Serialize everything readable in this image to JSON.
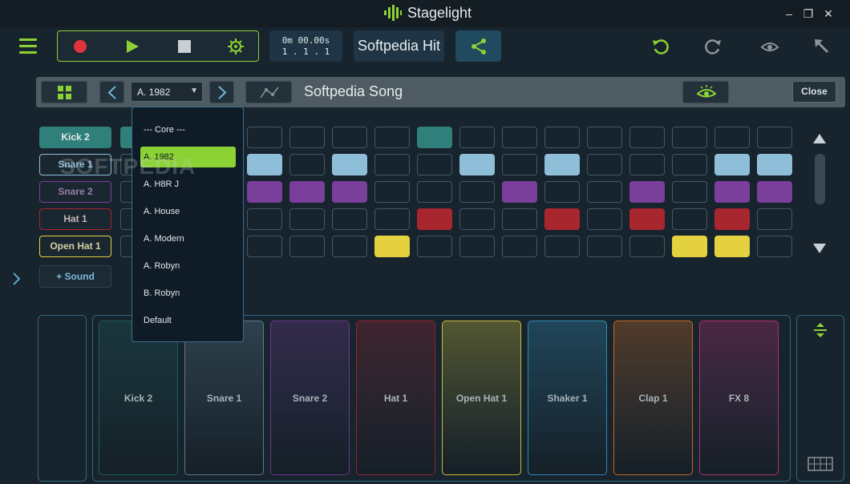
{
  "app": {
    "title": "Stagelight",
    "icon": "waveform-logo-icon"
  },
  "window_controls": {
    "minimize": "–",
    "maximize": "❐",
    "close": "✕"
  },
  "toolbar": {
    "time_top": "0m 00.00s",
    "time_bottom": "1 . 1 . 1",
    "project_title": "Softpedia Hit"
  },
  "songbar": {
    "preset": "A. 1982",
    "song_name": "Softpedia Song",
    "close_label": "Close"
  },
  "tracks": [
    {
      "label": "Kick 2",
      "color": "#2f7f7a",
      "active": true
    },
    {
      "label": "Snare 1",
      "color": "#8fbfd8",
      "active": false
    },
    {
      "label": "Snare 2",
      "color": "#7a3f9a",
      "active": false
    },
    {
      "label": "Hat 1",
      "color": "#a8262e",
      "active": false
    },
    {
      "label": "Open Hat 1",
      "color": "#e3d140",
      "active": false
    }
  ],
  "add_sound_label": "+ Sound",
  "step_grid": {
    "active_steps": [
      [
        0,
        0,
        0,
        0,
        1,
        0,
        0,
        0,
        0,
        0,
        0,
        0,
        0
      ],
      [
        1,
        0,
        1,
        0,
        0,
        1,
        0,
        1,
        0,
        0,
        0,
        1,
        1
      ],
      [
        1,
        1,
        1,
        0,
        0,
        0,
        1,
        0,
        0,
        1,
        0,
        1,
        1
      ],
      [
        0,
        0,
        0,
        0,
        1,
        0,
        0,
        1,
        0,
        1,
        0,
        1,
        0
      ],
      [
        0,
        0,
        0,
        1,
        0,
        0,
        0,
        0,
        0,
        0,
        1,
        1,
        0
      ]
    ]
  },
  "dropdown": {
    "items": [
      "--- Core ---",
      "A. 1982",
      "A. H8R J",
      "A. House",
      "A. Modern",
      "A. Robyn",
      "B. Robyn",
      "Default"
    ],
    "selected_index": 1
  },
  "pads": [
    {
      "label": "Kick 2",
      "color": "#1e5e56"
    },
    {
      "label": "Snare 1",
      "color": "#5e7c8a"
    },
    {
      "label": "Snare 2",
      "color": "#6a3a86"
    },
    {
      "label": "Hat 1",
      "color": "#8f2630"
    },
    {
      "label": "Open Hat 1",
      "color": "#c8bc3a"
    },
    {
      "label": "Shaker 1",
      "color": "#2f8bb0"
    },
    {
      "label": "Clap 1",
      "color": "#c46a24"
    },
    {
      "label": "FX 8",
      "color": "#b0306f"
    }
  ],
  "watermark": "SOFTPEDIA",
  "colors": {
    "accent": "#8cd234",
    "background": "#17232d",
    "panel_border": "#2e6781"
  }
}
